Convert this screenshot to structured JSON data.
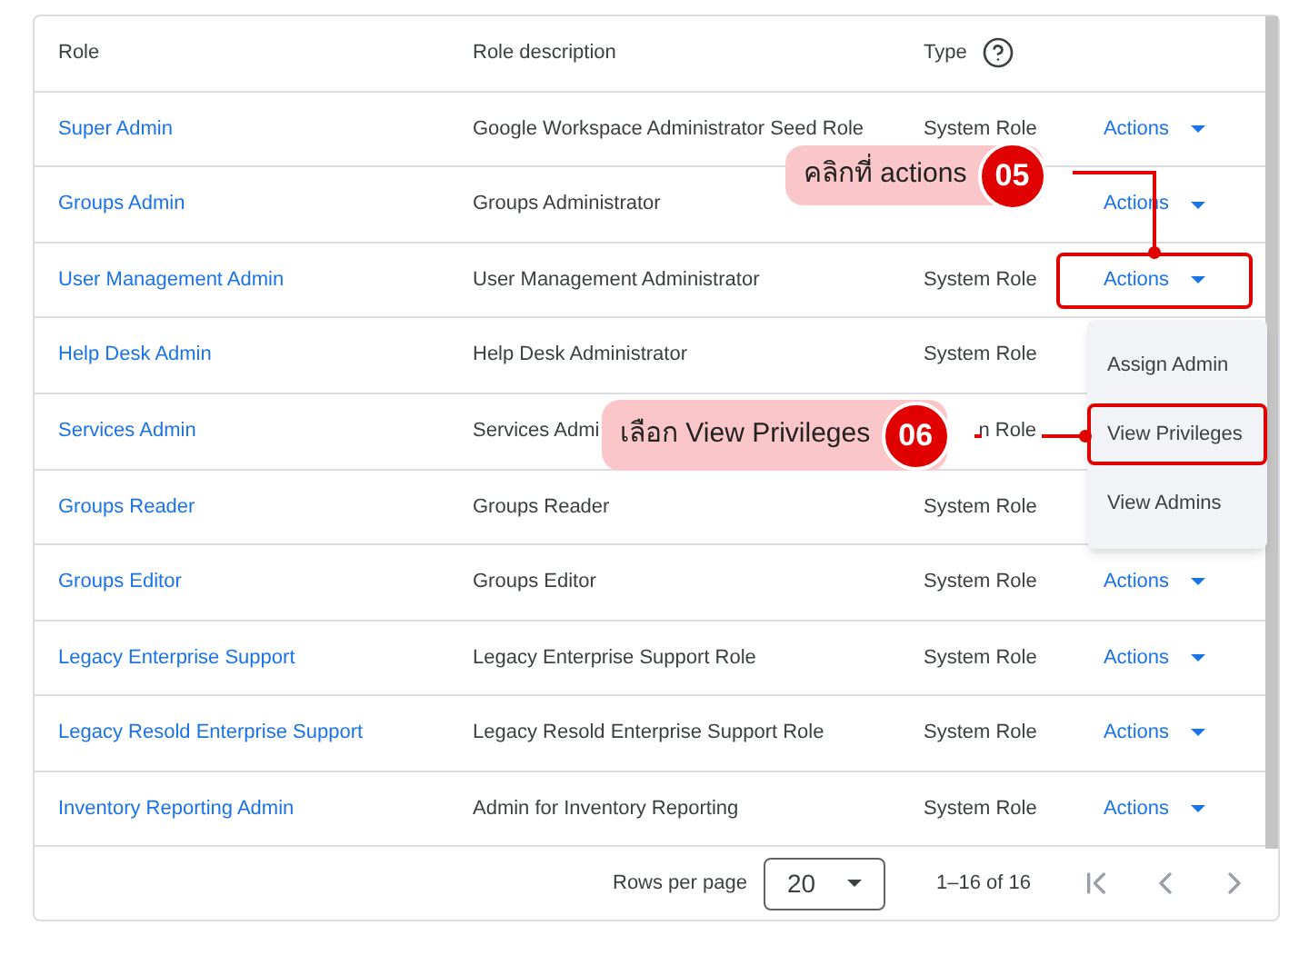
{
  "table": {
    "columns": [
      {
        "label": "Role"
      },
      {
        "label": "Role description"
      },
      {
        "label": "Type",
        "help": true
      }
    ],
    "rows": [
      {
        "role": "Super Admin",
        "description": "Google Workspace Administrator Seed Role",
        "type": "System Role",
        "action": "Actions"
      },
      {
        "role": "Groups Admin",
        "description": "Groups Administrator",
        "action": "Actions"
      },
      {
        "role": "User Management Admin",
        "description": "User Management Administrator",
        "type": "System Role",
        "action": "Actions",
        "highlighted": true
      },
      {
        "role": "Help Desk Admin",
        "description": "Help Desk Administrator",
        "type": "System Role"
      },
      {
        "role": "Services Admin",
        "description": "Services Admi",
        "type": "n Role"
      },
      {
        "role": "Groups Reader",
        "description": "Groups Reader",
        "type": "System Role"
      },
      {
        "role": "Groups Editor",
        "description": "Groups Editor",
        "type": "System Role",
        "action": "Actions"
      },
      {
        "role": "Legacy Enterprise Support",
        "description": "Legacy Enterprise Support Role",
        "type": "System Role",
        "action": "Actions"
      },
      {
        "role": "Legacy Resold Enterprise Support",
        "description": "Legacy Resold Enterprise Support Role",
        "type": "System Role",
        "action": "Actions"
      },
      {
        "role": "Inventory Reporting Admin",
        "description": "Admin for Inventory Reporting",
        "type": "System Role",
        "action": "Actions"
      }
    ]
  },
  "menu": {
    "items": [
      {
        "label": "Assign Admin",
        "highlighted": false
      },
      {
        "label": "View Privileges",
        "highlighted": true
      },
      {
        "label": "View Admins",
        "highlighted": false
      }
    ]
  },
  "pagination": {
    "rows_per_page_label": "Rows per page",
    "rows_per_page": "20",
    "range": "1–16 of 16"
  },
  "callouts": [
    {
      "text": "คลิกที่ actions",
      "number": "05"
    },
    {
      "text": "เลือก View Privileges",
      "number": "06"
    }
  ]
}
